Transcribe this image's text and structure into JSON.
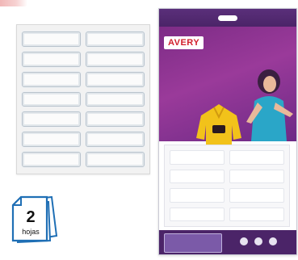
{
  "sheets_badge": {
    "count": "2",
    "unit": "hojas"
  },
  "label_sheet": {
    "label_count": 14
  },
  "package": {
    "brand": "AVERY",
    "colors": {
      "purple": "#7d2c86",
      "dark_purple": "#4b2468",
      "brand_red": "#d11f2b"
    }
  }
}
